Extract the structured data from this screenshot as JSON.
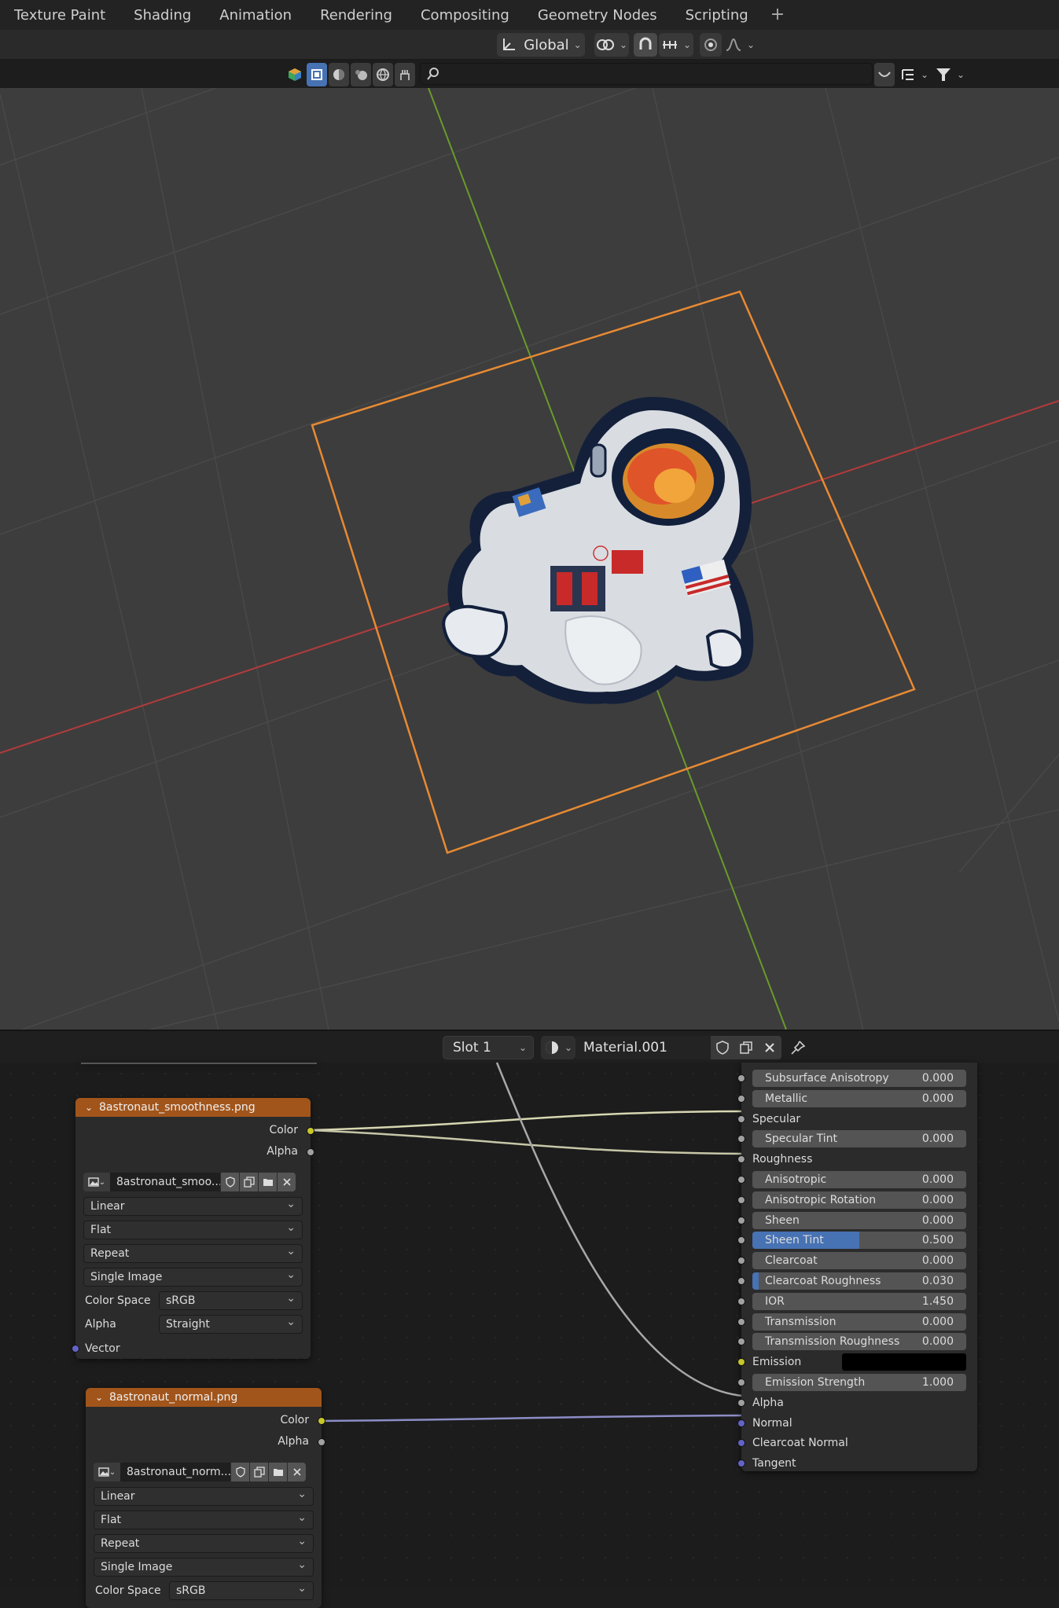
{
  "workspace_tabs": [
    "Texture Paint",
    "Shading",
    "Animation",
    "Rendering",
    "Compositing",
    "Geometry Nodes",
    "Scripting"
  ],
  "add_tab_symbol": "+",
  "header": {
    "orientation_label": "Global"
  },
  "node_header": {
    "slot_label": "Slot 1",
    "material_name": "Material.001"
  },
  "node_smoothness": {
    "title": "8astronaut_smoothness.png",
    "outputs": [
      "Color",
      "Alpha"
    ],
    "image_name": "8astronaut_smoo...",
    "interpolation": "Linear",
    "projection": "Flat",
    "extension": "Repeat",
    "source": "Single Image",
    "color_space_label": "Color Space",
    "color_space": "sRGB",
    "alpha_label": "Alpha",
    "alpha": "Straight",
    "input": "Vector"
  },
  "node_normal": {
    "title": "8astronaut_normal.png",
    "outputs": [
      "Color",
      "Alpha"
    ],
    "image_name": "8astronaut_norm...",
    "interpolation": "Linear",
    "projection": "Flat",
    "extension": "Repeat",
    "source": "Single Image",
    "color_space_label": "Color Space",
    "color_space": "sRGB"
  },
  "bsdf": {
    "rows": [
      {
        "label": "Subsurface Anisotropy",
        "value": "0.000",
        "fill": 0
      },
      {
        "label": "Metallic",
        "value": "0.000",
        "fill": 0
      },
      {
        "label": "Specular",
        "value": "",
        "fill": 0
      },
      {
        "label": "Specular Tint",
        "value": "0.000",
        "fill": 0
      },
      {
        "label": "Roughness",
        "value": "",
        "fill": 0
      },
      {
        "label": "Anisotropic",
        "value": "0.000",
        "fill": 0
      },
      {
        "label": "Anisotropic Rotation",
        "value": "0.000",
        "fill": 0
      },
      {
        "label": "Sheen",
        "value": "0.000",
        "fill": 0
      },
      {
        "label": "Sheen Tint",
        "value": "0.500",
        "fill": 0.5
      },
      {
        "label": "Clearcoat",
        "value": "0.000",
        "fill": 0
      },
      {
        "label": "Clearcoat Roughness",
        "value": "0.030",
        "fill": 0.03
      },
      {
        "label": "IOR",
        "value": "1.450",
        "fill": 0
      },
      {
        "label": "Transmission",
        "value": "0.000",
        "fill": 0
      },
      {
        "label": "Transmission Roughness",
        "value": "0.000",
        "fill": 0
      },
      {
        "label": "Emission",
        "value": "",
        "fill": 0
      },
      {
        "label": "Emission Strength",
        "value": "1.000",
        "fill": 0
      },
      {
        "label": "Alpha",
        "value": "",
        "fill": 0
      },
      {
        "label": "Normal",
        "value": "",
        "fill": 0
      },
      {
        "label": "Clearcoat Normal",
        "value": "",
        "fill": 0
      },
      {
        "label": "Tangent",
        "value": "",
        "fill": 0
      }
    ]
  },
  "colors": {
    "accent": "#4772b3",
    "selection_outline": "#e88a33",
    "node_header": "#a1551b",
    "socket_color": "#c7c729",
    "socket_gray": "#a1a1a1",
    "socket_vector": "#6363c7",
    "axis_x": "#b33b3b",
    "axis_y": "#6a9a2b"
  }
}
